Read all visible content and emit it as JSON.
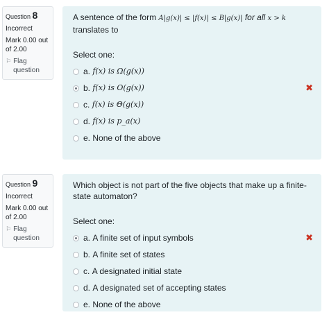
{
  "q8": {
    "number_label": "Question",
    "number": "8",
    "status": "Incorrect",
    "mark": "Mark 0.00 out of 2.00",
    "flag": "Flag question",
    "text_before": "A sentence of the form ",
    "text_math": "A|g(x)| ≤ |f(x)| ≤ B|g(x)|",
    "text_mid": " for all ",
    "text_math2": "x > k",
    "text_after": " translates to",
    "select": "Select one:",
    "answers": [
      {
        "letter": "a.",
        "text": "f(x) is Ω(g(x))"
      },
      {
        "letter": "b.",
        "text": "f(x) is O(g(x))"
      },
      {
        "letter": "c.",
        "text": "f(x) is Θ(g(x))"
      },
      {
        "letter": "d.",
        "text": "f(x) is p_a(x)"
      },
      {
        "letter": "e.",
        "text": "None of the above"
      }
    ]
  },
  "q9": {
    "number_label": "Question",
    "number": "9",
    "status": "Incorrect",
    "mark": "Mark 0.00 out of 2.00",
    "flag": "Flag question",
    "text": "Which object is not part of the five objects that make up a finite-state automaton?",
    "select": "Select one:",
    "answers": [
      {
        "letter": "a.",
        "text": "A finite set of input symbols"
      },
      {
        "letter": "b.",
        "text": "A finite set of states"
      },
      {
        "letter": "c.",
        "text": "A designated initial state"
      },
      {
        "letter": "d.",
        "text": "A designated set of accepting states"
      },
      {
        "letter": "e.",
        "text": "None of the above"
      }
    ]
  },
  "icons": {
    "flag": "flag-icon",
    "incorrect": "incorrect-x-icon",
    "radio": "radio-icon"
  },
  "colors": {
    "panel": "#e7f3f5",
    "incorrect": "#ca3120"
  }
}
